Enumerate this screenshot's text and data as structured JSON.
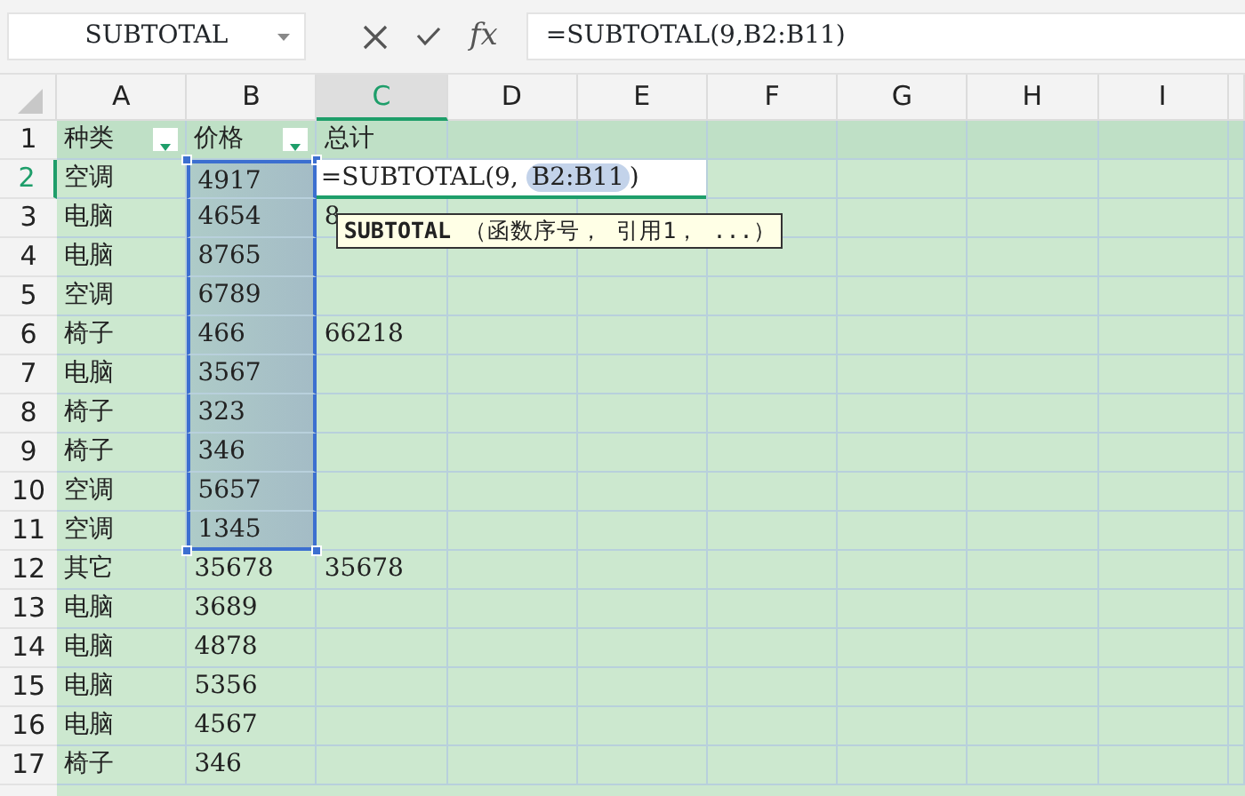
{
  "name_box": {
    "value": "SUBTOTAL"
  },
  "formula_bar": {
    "fx": "fx",
    "value": "=SUBTOTAL(9,B2:B11)"
  },
  "columns": [
    {
      "label": "A",
      "selected": false
    },
    {
      "label": "B",
      "selected": false
    },
    {
      "label": "C",
      "selected": true
    },
    {
      "label": "D",
      "selected": false
    },
    {
      "label": "E",
      "selected": false
    },
    {
      "label": "F",
      "selected": false
    },
    {
      "label": "G",
      "selected": false
    },
    {
      "label": "H",
      "selected": false
    },
    {
      "label": "I",
      "selected": false
    }
  ],
  "rows": [
    {
      "number": "1",
      "selected": false,
      "header": true,
      "cells": [
        {
          "text": "种类",
          "filter": true,
          "selected": false
        },
        {
          "text": "价格",
          "filter": true,
          "selected": false
        },
        {
          "text": "总计",
          "selected": false
        }
      ]
    },
    {
      "number": "2",
      "selected": true,
      "cells": [
        {
          "text": "空调",
          "selected": false
        },
        {
          "text": "4917",
          "selected": true
        },
        {
          "selected": false,
          "editing": true
        }
      ]
    },
    {
      "number": "3",
      "selected": false,
      "cells": [
        {
          "text": "电脑",
          "selected": false
        },
        {
          "text": "4654",
          "selected": true
        },
        {
          "text": "8",
          "selected": false,
          "tooltip": true
        }
      ]
    },
    {
      "number": "4",
      "selected": false,
      "cells": [
        {
          "text": "电脑",
          "selected": false
        },
        {
          "text": "8765",
          "selected": true
        }
      ]
    },
    {
      "number": "5",
      "selected": false,
      "cells": [
        {
          "text": "空调",
          "selected": false
        },
        {
          "text": "6789",
          "selected": true
        }
      ]
    },
    {
      "number": "6",
      "selected": false,
      "cells": [
        {
          "text": "椅子",
          "selected": false
        },
        {
          "text": "466",
          "selected": true
        },
        {
          "text": "66218",
          "selected": false
        }
      ]
    },
    {
      "number": "7",
      "selected": false,
      "cells": [
        {
          "text": "电脑",
          "selected": false
        },
        {
          "text": "3567",
          "selected": true
        }
      ]
    },
    {
      "number": "8",
      "selected": false,
      "cells": [
        {
          "text": "椅子",
          "selected": false
        },
        {
          "text": "323",
          "selected": true
        }
      ]
    },
    {
      "number": "9",
      "selected": false,
      "cells": [
        {
          "text": "椅子",
          "selected": false
        },
        {
          "text": "346",
          "selected": true
        }
      ]
    },
    {
      "number": "10",
      "selected": false,
      "cells": [
        {
          "text": "空调",
          "selected": false
        },
        {
          "text": "5657",
          "selected": true
        }
      ]
    },
    {
      "number": "11",
      "selected": false,
      "cells": [
        {
          "text": "空调",
          "selected": false
        },
        {
          "text": "1345",
          "selected": true
        }
      ]
    },
    {
      "number": "12",
      "selected": false,
      "cells": [
        {
          "text": "其它",
          "selected": false
        },
        {
          "text": "35678",
          "selected": false
        },
        {
          "text": "35678",
          "selected": false
        }
      ]
    },
    {
      "number": "13",
      "selected": false,
      "cells": [
        {
          "text": "电脑",
          "selected": false
        },
        {
          "text": "3689",
          "selected": false
        }
      ]
    },
    {
      "number": "14",
      "selected": false,
      "cells": [
        {
          "text": "电脑",
          "selected": false
        },
        {
          "text": "4878",
          "selected": false
        }
      ]
    },
    {
      "number": "15",
      "selected": false,
      "cells": [
        {
          "text": "电脑",
          "selected": false
        },
        {
          "text": "5356",
          "selected": false
        }
      ]
    },
    {
      "number": "16",
      "selected": false,
      "cells": [
        {
          "text": "电脑",
          "selected": false
        },
        {
          "text": "4567",
          "selected": false
        }
      ]
    },
    {
      "number": "17",
      "selected": false,
      "cells": [
        {
          "text": "椅子",
          "selected": false
        },
        {
          "text": "346",
          "selected": false
        }
      ]
    }
  ],
  "cell_editor": {
    "prefix": "=SUBTOTAL(9, ",
    "reference": "B2:B11",
    "suffix": ")"
  },
  "tooltip": {
    "text": "**SUBTOTAL** （函数序号， 引用1， ...）"
  }
}
